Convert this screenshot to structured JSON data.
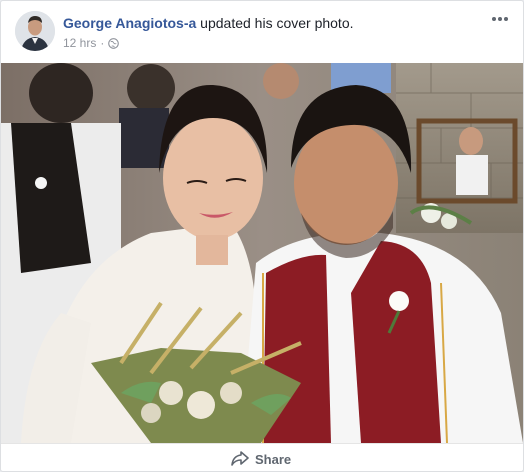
{
  "post": {
    "author": "George Anagiotos-a",
    "action": "updated his cover photo.",
    "time": "12 hrs",
    "privacy_icon": "globe-icon",
    "more_icon": "more-options-icon"
  },
  "footer": {
    "share_label": "Share",
    "share_icon": "share-arrow-icon"
  },
  "colors": {
    "author_link": "#365899",
    "meta_text": "#90949c",
    "footer_text": "#606770",
    "vest": "#8c1c24"
  }
}
